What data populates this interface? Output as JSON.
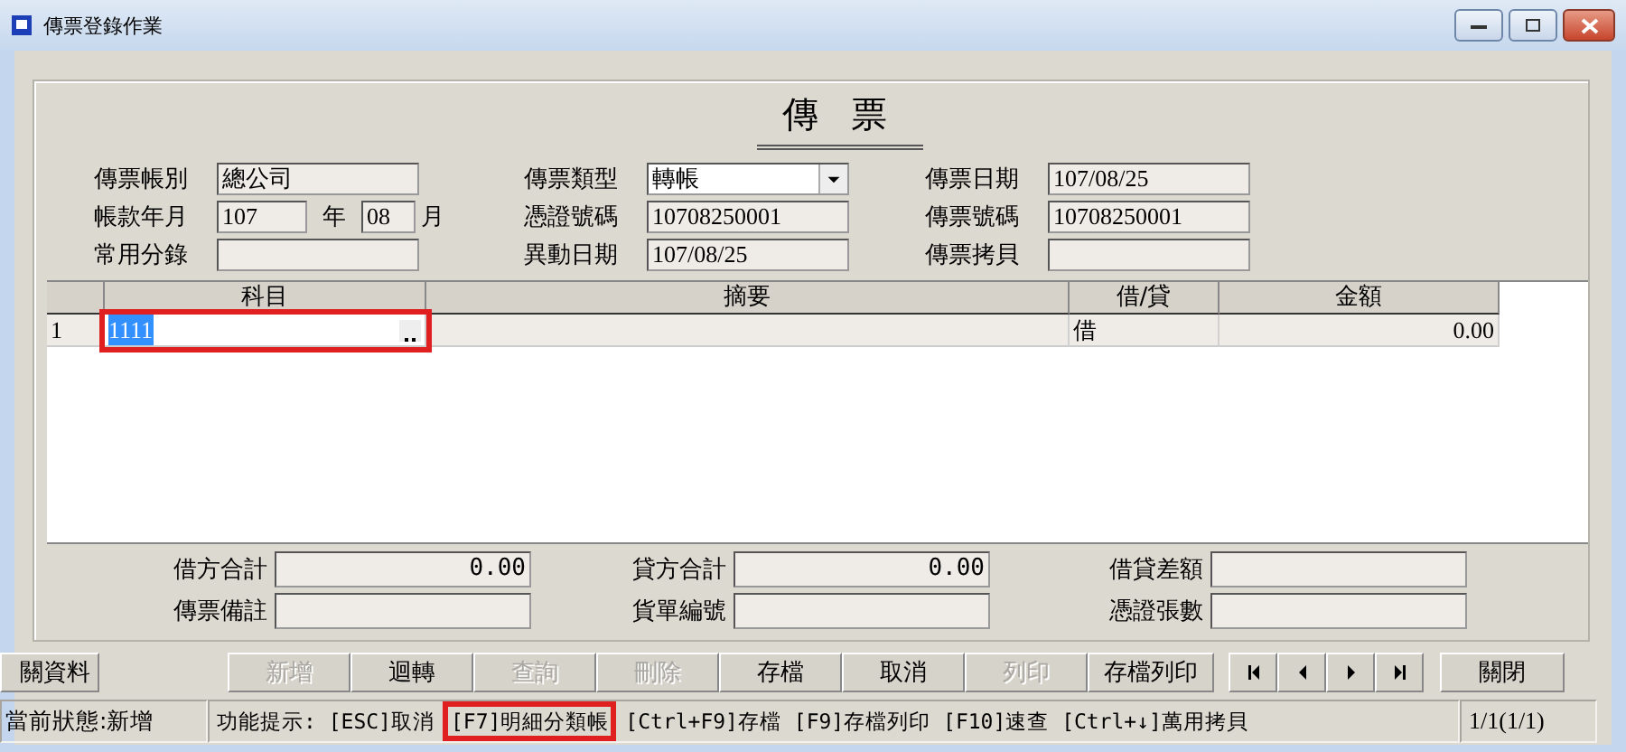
{
  "window": {
    "title": "傳票登錄作業"
  },
  "heading": "傳 票",
  "form_columns": [
    [
      {
        "kind": "text",
        "label": "傳票帳別",
        "value": "總公司"
      },
      {
        "kind": "period",
        "label": "帳款年月",
        "year": "107",
        "year_unit": "年",
        "month": "08",
        "month_unit": "月"
      },
      {
        "kind": "text",
        "label": "常用分錄"
      }
    ],
    [
      {
        "kind": "dropdown",
        "label": "傳票類型",
        "value": "轉帳"
      },
      {
        "kind": "text",
        "label": "憑證號碼",
        "value": "10708250001"
      },
      {
        "kind": "text",
        "label": "異動日期",
        "value": "107/08/25"
      }
    ],
    [
      {
        "kind": "text",
        "label": "傳票日期",
        "value": "107/08/25"
      },
      {
        "kind": "text",
        "label": "傳票號碼",
        "value": "10708250001"
      },
      {
        "kind": "text",
        "label": "傳票拷貝"
      }
    ]
  ],
  "grid": {
    "columns": [
      "科目",
      "摘要",
      "借/貸",
      "金額"
    ],
    "rows": [
      {
        "number": "1",
        "account": "1111",
        "account_editing": true,
        "account_highlighted": true,
        "summary": "",
        "side": "借",
        "amount": "0.00"
      }
    ]
  },
  "totals": [
    [
      {
        "label": "借方合計",
        "value": "0.00"
      },
      {
        "label": "貸方合計",
        "value": "0.00"
      },
      {
        "label": "借貸差額"
      }
    ],
    [
      {
        "label": "傳票備註"
      },
      {
        "label": "貨單編號"
      },
      {
        "label": "憑證張數"
      }
    ]
  ],
  "side_button": {
    "label": "關資料"
  },
  "buttons": [
    {
      "label": "新增",
      "disabled": true
    },
    {
      "label": "迴轉",
      "disabled": false
    },
    {
      "label": "查詢",
      "disabled": true
    },
    {
      "label": "刪除",
      "disabled": true
    },
    {
      "label": "存檔",
      "disabled": false
    },
    {
      "label": "取消",
      "disabled": false
    },
    {
      "label": "列印",
      "disabled": true
    },
    {
      "label": "存檔列印",
      "disabled": false
    }
  ],
  "nav_buttons": [
    {
      "kind": "first"
    },
    {
      "kind": "prev"
    },
    {
      "kind": "next"
    },
    {
      "kind": "last"
    }
  ],
  "close_button": {
    "label": "關閉"
  },
  "status_bar": {
    "state": "當前狀態:新增",
    "hints": [
      {
        "text": "功能提示: [ESC]取消",
        "highlighted": false
      },
      {
        "text": "[F7]明細分類帳",
        "highlighted": true
      },
      {
        "text": "[Ctrl+F9]存檔 [F9]存檔列印 [F10]速查 [Ctrl+↓]萬用拷貝",
        "highlighted": false
      }
    ],
    "record": "1/1(1/1)"
  }
}
